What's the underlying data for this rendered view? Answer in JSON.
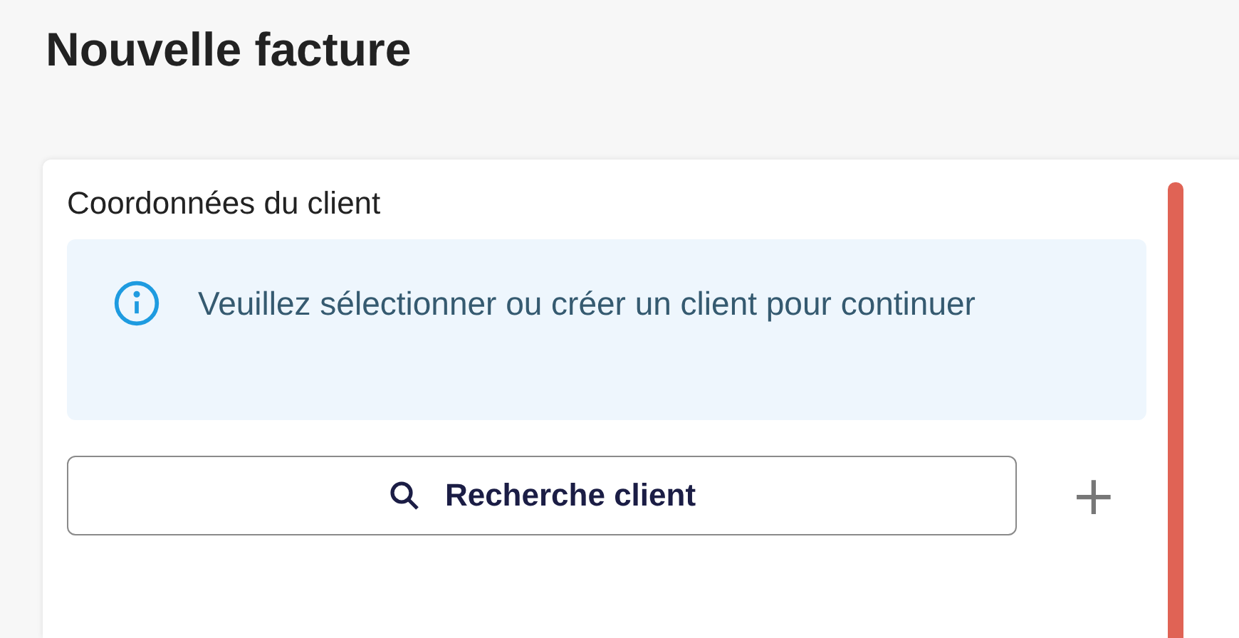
{
  "page": {
    "title": "Nouvelle facture"
  },
  "client_card": {
    "title": "Coordonnées du client",
    "info": {
      "text": "Veuillez sélectionner ou créer un client pour continuer"
    },
    "search_button": {
      "label": "Recherche client"
    },
    "add_button": {
      "label": "+"
    }
  }
}
